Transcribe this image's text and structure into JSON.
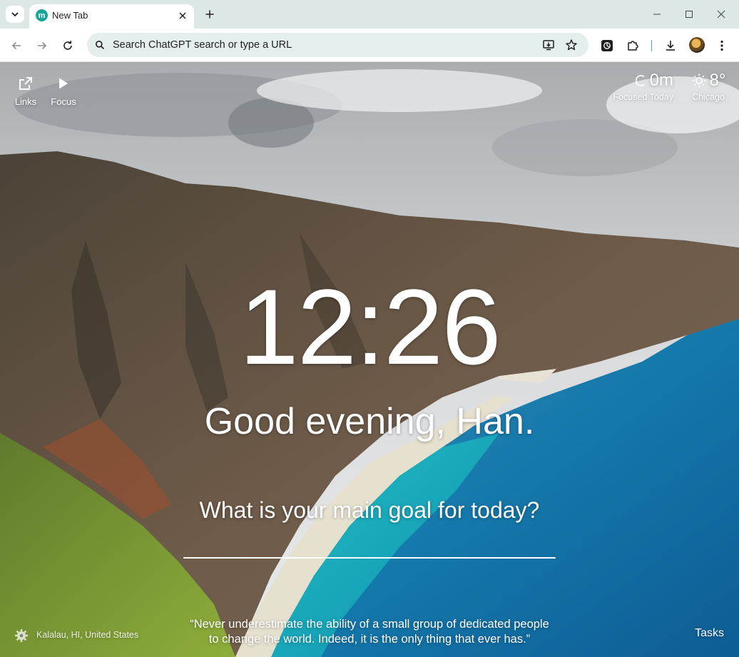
{
  "browser": {
    "tab": {
      "title": "New Tab",
      "favicon_letter": "m"
    },
    "omnibox": {
      "placeholder": "Search ChatGPT search or type a URL",
      "value": ""
    },
    "icons": [
      "tab-search-icon",
      "close-icon",
      "plus-icon",
      "minimize-icon",
      "maximize-icon",
      "close-window-icon",
      "back-icon",
      "forward-icon",
      "reload-icon",
      "search-icon",
      "install-app-icon",
      "bookmark-star-icon",
      "chatgpt-extension-icon",
      "extensions-puzzle-icon",
      "download-icon",
      "kebab-menu-icon"
    ]
  },
  "page": {
    "top_left": {
      "links_label": "Links",
      "focus_label": "Focus"
    },
    "focus_metric": {
      "value": "0m",
      "label": "Focused Today"
    },
    "weather": {
      "value": "8°",
      "location": "Chicago",
      "icon": "sun-icon"
    },
    "clock": "12:26",
    "greeting": "Good evening, Han.",
    "goal_prompt": "What is your main goal for today?",
    "goal_value": "",
    "photo_location": "Kalalau, HI, United States",
    "quote_line1": "“Never underestimate the ability of a small group of dedicated people",
    "quote_line2": "to change the world. Indeed, it is the only thing that ever has.”",
    "tasks_label": "Tasks"
  },
  "colors": {
    "chrome_bg": "#dce8e6",
    "omnibox_bg": "#e4eeec",
    "favicon": "#1aa39a",
    "ocean": "#1479a8",
    "text": "#ffffff"
  }
}
